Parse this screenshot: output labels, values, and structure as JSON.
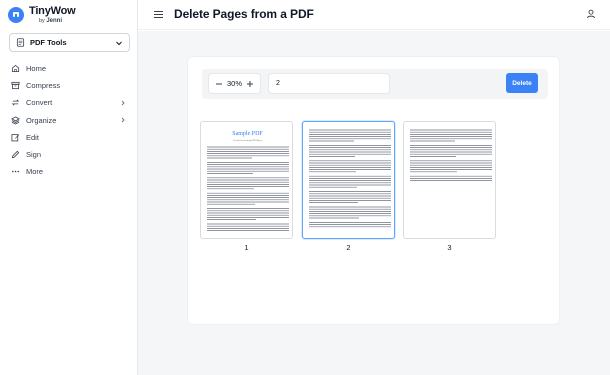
{
  "brand": {
    "name": "TinyWow",
    "by": "by",
    "by_name": "Jenni",
    "color": "#3b82f6"
  },
  "tools_select": {
    "label": "PDF Tools"
  },
  "nav": {
    "items": [
      {
        "label": "Home",
        "icon": "home-icon"
      },
      {
        "label": "Compress",
        "icon": "archive-icon"
      },
      {
        "label": "Convert",
        "icon": "convert-icon",
        "has_submenu": true
      },
      {
        "label": "Organize",
        "icon": "layers-icon",
        "has_submenu": true
      },
      {
        "label": "Edit",
        "icon": "edit-icon"
      },
      {
        "label": "Sign",
        "icon": "pen-icon"
      },
      {
        "label": "More",
        "icon": "more-icon"
      }
    ]
  },
  "header": {
    "title": "Delete Pages from a PDF"
  },
  "toolbar": {
    "zoom_value": "30%",
    "pages_input_value": "2",
    "delete_label": "Delete"
  },
  "pages": [
    {
      "number": "1",
      "heading": "Sample PDF",
      "subheading": "Created for testing PDFObject",
      "selected": false
    },
    {
      "number": "2",
      "selected": true
    },
    {
      "number": "3",
      "selected": false
    }
  ],
  "colors": {
    "accent": "#3b82f6",
    "selected_border": "#60a5fa",
    "page_heading": "#3b82f6"
  }
}
